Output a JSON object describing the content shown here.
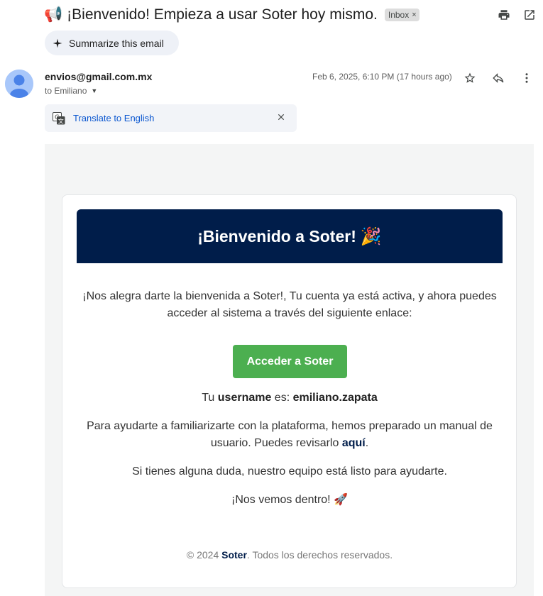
{
  "subject": {
    "emoji": "📢",
    "text": "¡Bienvenido! Empieza a usar Soter hoy mismo.",
    "label_chip": "Inbox",
    "chip_close": "×"
  },
  "toolbar_icons": [
    "print-icon",
    "open-in-new-window-icon"
  ],
  "summarize": {
    "label": "Summarize this email",
    "icon": "sparkle-icon"
  },
  "message": {
    "sender": "envios@gmail.com.mx",
    "to": "to Emiliano",
    "date": "Feb 6, 2025, 6:10 PM (17 hours ago)",
    "actions": [
      "star-icon",
      "reply-icon",
      "more-vert-icon"
    ]
  },
  "translate": {
    "label": "Translate to English",
    "icon": "google-translate-icon"
  },
  "email": {
    "banner_title": "¡Bienvenido a Soter!",
    "banner_emoji": "🎉",
    "intro": "¡Nos alegra darte la bienvenida a Soter!, Tu cuenta ya está activa, y ahora puedes acceder al sistema a través del siguiente enlace:",
    "cta_label": "Acceder a Soter",
    "username_prefix": "Tu ",
    "username_word": "username",
    "username_mid": " es: ",
    "username_value": "emiliano.zapata",
    "manual_text": "Para ayudarte a familiarizarte con la plataforma, hemos preparado un manual de usuario. Puedes revisarlo ",
    "manual_link": "aquí",
    "manual_end": ".",
    "help_text": "Si tienes alguna duda, nuestro equipo está listo para ayudarte.",
    "see_you": "¡Nos vemos dentro!",
    "see_you_emoji": "🚀",
    "footer_prefix": "© 2024 ",
    "footer_brand": "Soter",
    "footer_suffix": ". Todos los derechos reservados."
  },
  "colors": {
    "banner_bg": "#001d4a",
    "cta_bg": "#4caf50",
    "link": "#0b57d0",
    "avatar_bg": "#a8c7fa"
  }
}
